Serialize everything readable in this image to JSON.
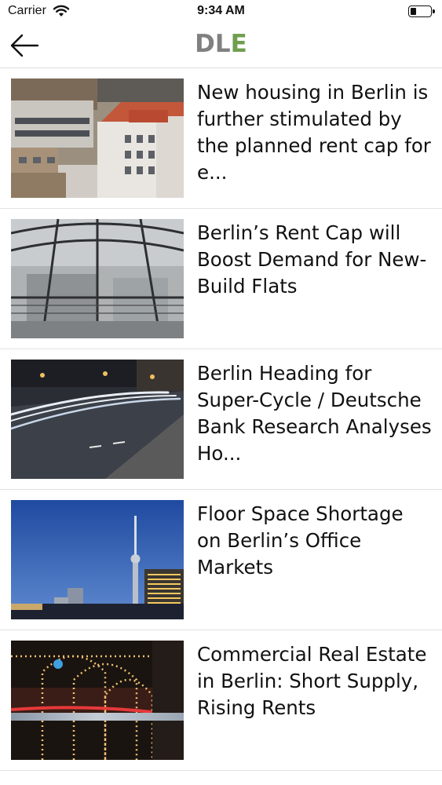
{
  "status_bar": {
    "carrier": "Carrier",
    "time": "9:34 AM"
  },
  "nav": {
    "logo_dl": "DL",
    "logo_e": "E",
    "logo_colors": {
      "dl": "#808080",
      "e": "#6f9e4f"
    }
  },
  "news": [
    {
      "headline": "New housing in Berlin is further stimulated by the planned rent  cap for e...",
      "image_icon": "berlin-rooftops-photo"
    },
    {
      "headline": "Berlin’s Rent Cap will Boost Demand for New-Build Flats",
      "image_icon": "glass-dome-photo"
    },
    {
      "headline": "Berlin Heading for Super-Cycle / Deutsche Bank Research Analyses Ho...",
      "image_icon": "night-street-light-trails-photo"
    },
    {
      "headline": "Floor Space Shortage on Berlin’s Office Markets",
      "image_icon": "tv-tower-dusk-photo"
    },
    {
      "headline": "Commercial Real Estate in Berlin: Short Supply, Rising Rents",
      "image_icon": "illuminated-arches-photo"
    }
  ]
}
